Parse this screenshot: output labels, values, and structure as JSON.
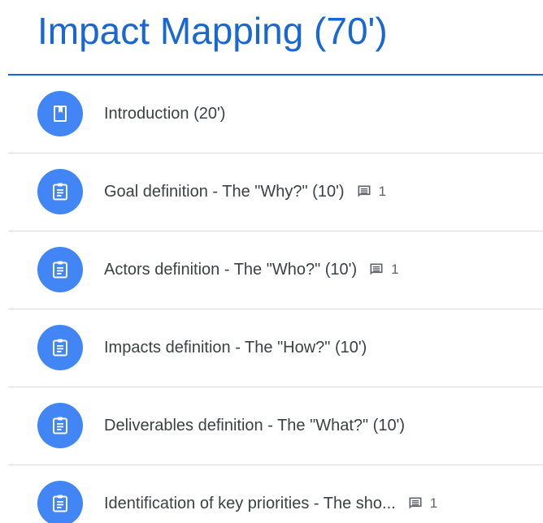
{
  "topic": {
    "title": "Impact Mapping (70')"
  },
  "items": [
    {
      "label": "Introduction (20')",
      "icon": "book-icon",
      "comments": null
    },
    {
      "label": "Goal definition - The \"Why?\" (10')",
      "icon": "assignment-icon",
      "comments": "1"
    },
    {
      "label": "Actors definition - The \"Who?\" (10')",
      "icon": "assignment-icon",
      "comments": "1"
    },
    {
      "label": "Impacts definition - The \"How?\" (10')",
      "icon": "assignment-icon",
      "comments": null
    },
    {
      "label": "Deliverables definition - The \"What?\" (10')",
      "icon": "assignment-icon",
      "comments": null
    },
    {
      "label": "Identification of key priorities - The sho...",
      "icon": "assignment-icon",
      "comments": "1"
    }
  ],
  "colors": {
    "accent": "#1967d2",
    "icon_circle": "#4285f4",
    "text": "#3c4043",
    "muted": "#5f6368",
    "divider": "#dadce0"
  }
}
